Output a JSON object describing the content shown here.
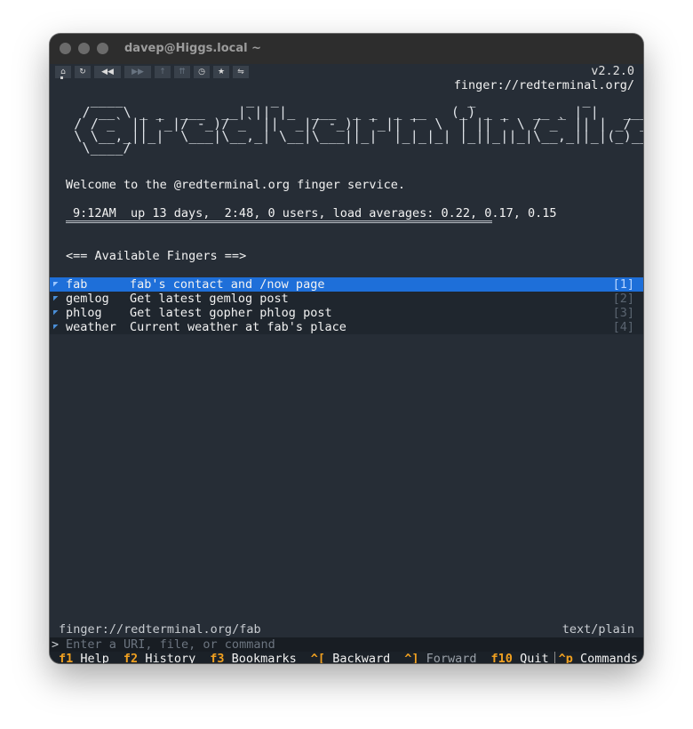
{
  "window": {
    "title": "davep@Higgs.local ~"
  },
  "toolbar": {
    "buttons": [
      {
        "name": "home-icon",
        "glyph": "⌂",
        "enabled": true
      },
      {
        "name": "reload-icon",
        "glyph": "↻",
        "enabled": true
      },
      {
        "name": "back-icon",
        "glyph": "◀◀",
        "enabled": true
      },
      {
        "name": "forward-icon",
        "glyph": "▶▶",
        "enabled": false
      },
      {
        "name": "up-icon",
        "glyph": "↑",
        "enabled": false
      },
      {
        "name": "root-icon",
        "glyph": "⇈",
        "enabled": false
      },
      {
        "name": "history-icon",
        "glyph": "◷",
        "enabled": true
      },
      {
        "name": "bookmark-icon",
        "glyph": "★",
        "enabled": true
      },
      {
        "name": "identity-icon",
        "glyph": "⇋",
        "enabled": true
      }
    ]
  },
  "version": "v2.2.0",
  "location": "finger://redterminal.org/",
  "welcome": "Welcome to the @redterminal.org finger service.",
  "uptime": "9:12AM  up 13 days,  2:48, 0 users, load averages: 0.22, 0.17, 0.15",
  "available_heading": "<== Available Fingers ==>",
  "fingers": [
    {
      "name": "fab",
      "desc": "fab's contact and /now page",
      "num": "[1]"
    },
    {
      "name": "gemlog",
      "desc": "Get latest gemlog post",
      "num": "[2]"
    },
    {
      "name": "phlog",
      "desc": "Get latest gopher phlog post",
      "num": "[3]"
    },
    {
      "name": "weather",
      "desc": "Current weather at fab's place",
      "num": "[4]"
    }
  ],
  "status": {
    "url": "finger://redterminal.org/fab",
    "mime": "text/plain"
  },
  "input": {
    "prompt": ">",
    "placeholder": "Enter a URI, file, or command"
  },
  "keys": [
    {
      "key": "f1",
      "label": "Help"
    },
    {
      "key": "f2",
      "label": "History"
    },
    {
      "key": "f3",
      "label": "Bookmarks"
    },
    {
      "key": "^[",
      "label": "Backward"
    },
    {
      "key": "^]",
      "label": "Forward"
    },
    {
      "key": "f10",
      "label": "Quit"
    },
    {
      "key": "^p",
      "label": "Commands"
    }
  ]
}
